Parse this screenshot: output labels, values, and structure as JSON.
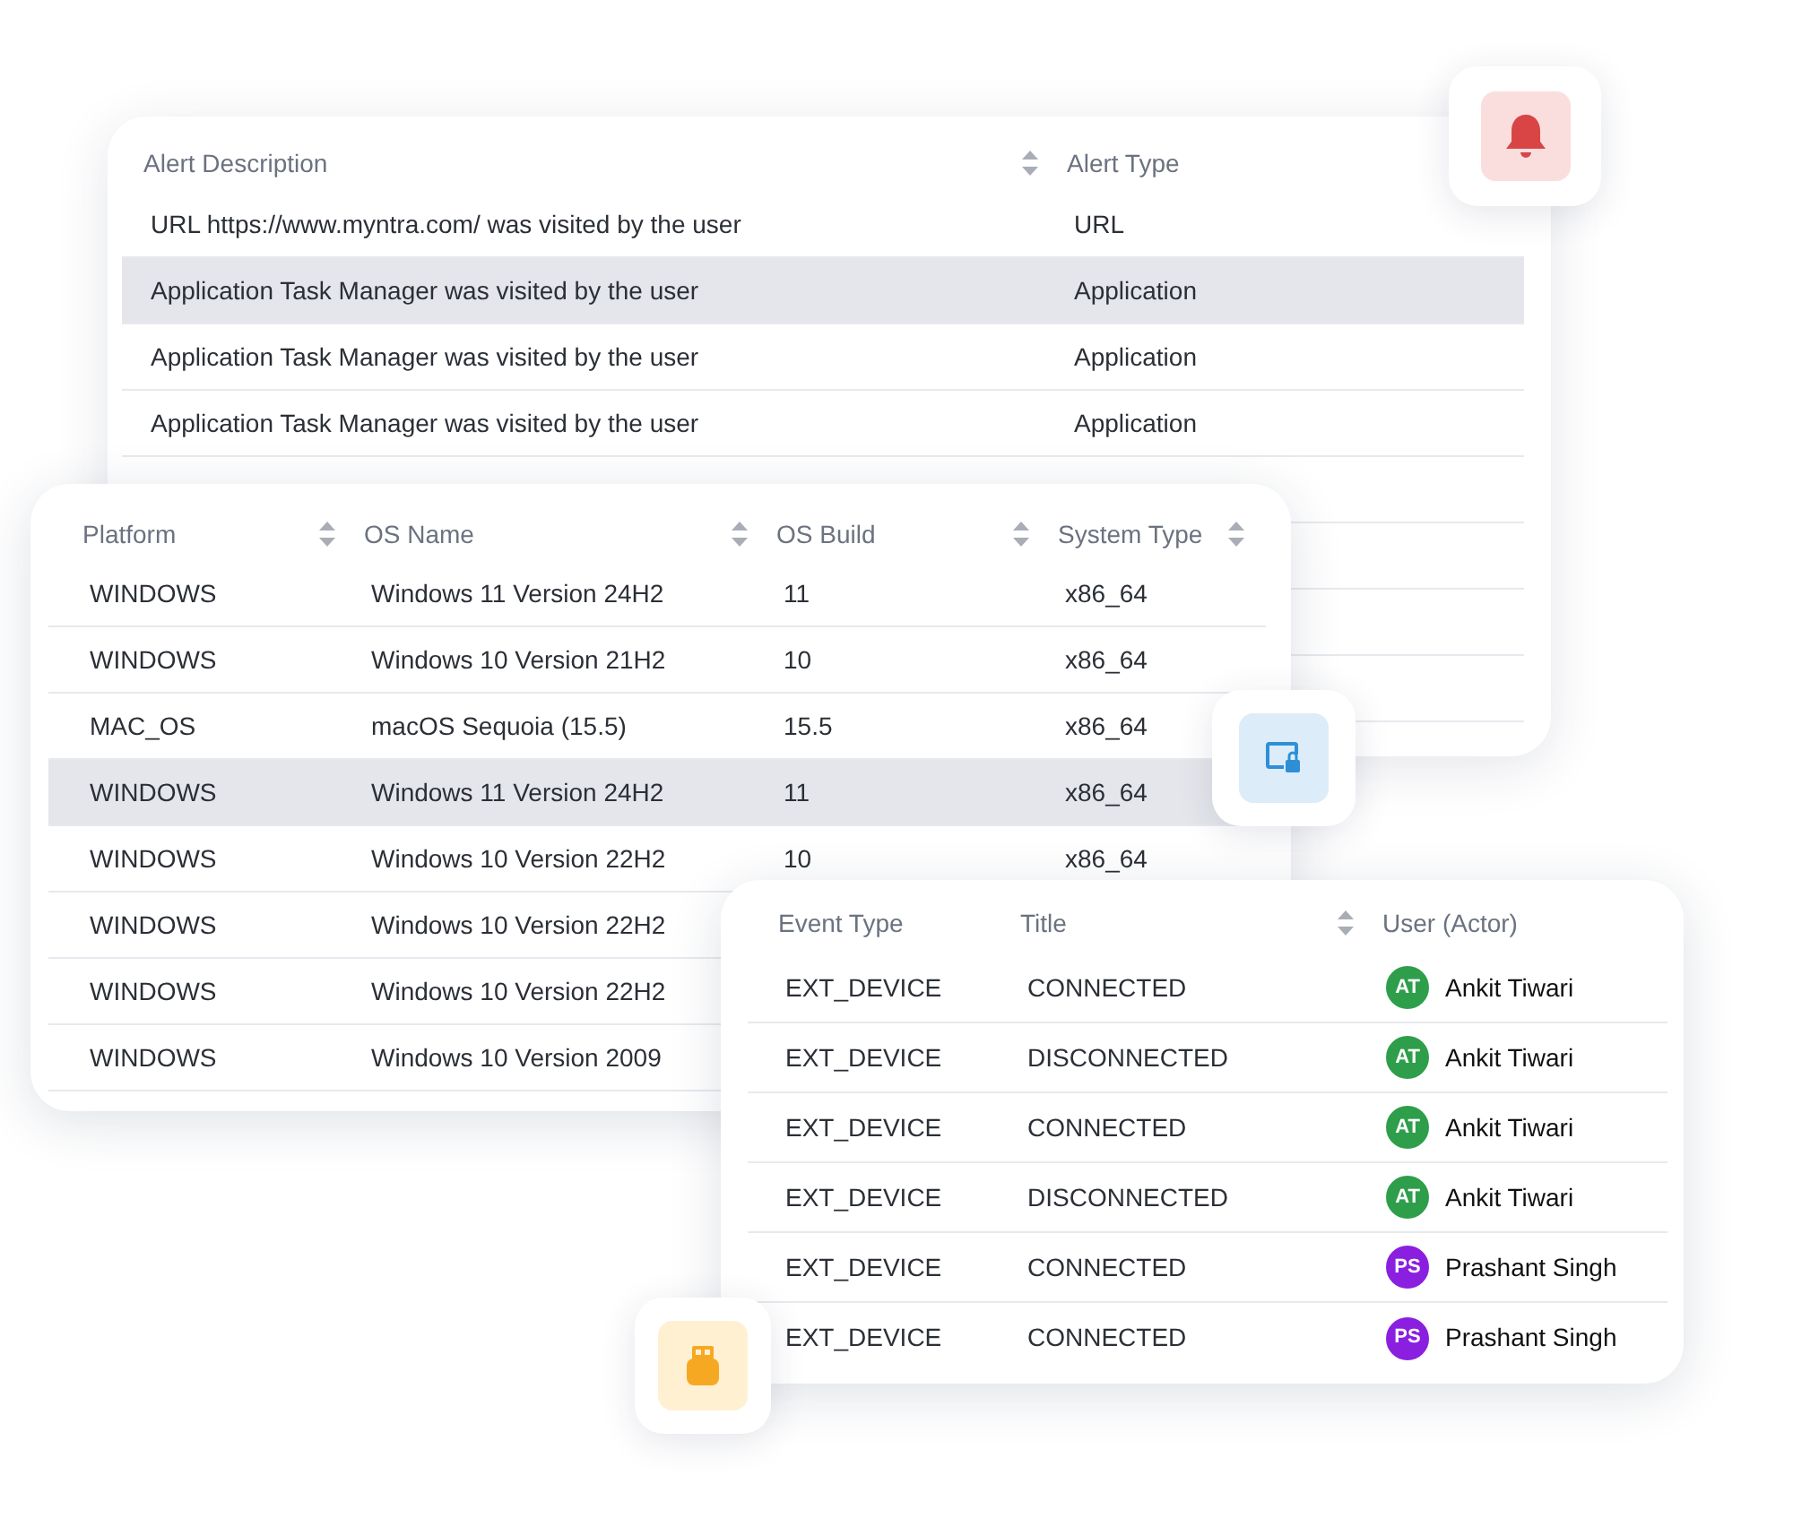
{
  "alerts_table": {
    "columns": [
      {
        "label": "Alert Description",
        "sortable": true
      },
      {
        "label": "Alert Type",
        "sortable": false
      }
    ],
    "rows": [
      {
        "cells": [
          "URL https://www.myntra.com/ was visited by the user",
          "URL"
        ],
        "highlighted": false
      },
      {
        "cells": [
          "Application Task Manager was visited by the user",
          "Application"
        ],
        "highlighted": true
      },
      {
        "cells": [
          "Application Task Manager was visited by the user",
          "Application"
        ],
        "highlighted": false
      },
      {
        "cells": [
          "Application Task Manager was visited by the user",
          "Application"
        ],
        "highlighted": false
      }
    ]
  },
  "platform_table": {
    "columns": [
      {
        "label": "Platform",
        "sortable": true
      },
      {
        "label": "OS Name",
        "sortable": true
      },
      {
        "label": "OS Build",
        "sortable": true
      },
      {
        "label": "System Type",
        "sortable": true
      }
    ],
    "rows": [
      {
        "cells": [
          "WINDOWS",
          "Windows 11 Version 24H2",
          "11",
          "x86_64"
        ],
        "highlighted": false
      },
      {
        "cells": [
          "WINDOWS",
          "Windows 10 Version 21H2",
          "10",
          "x86_64"
        ],
        "highlighted": false
      },
      {
        "cells": [
          "MAC_OS",
          "macOS Sequoia (15.5)",
          "15.5",
          "x86_64"
        ],
        "highlighted": false
      },
      {
        "cells": [
          "WINDOWS",
          "Windows 11 Version 24H2",
          "11",
          "x86_64"
        ],
        "highlighted": true
      },
      {
        "cells": [
          "WINDOWS",
          "Windows 10 Version 22H2",
          "10",
          "x86_64"
        ],
        "highlighted": false
      },
      {
        "cells": [
          "WINDOWS",
          "Windows 10 Version 22H2"
        ],
        "highlighted": false
      },
      {
        "cells": [
          "WINDOWS",
          "Windows 10 Version 22H2"
        ],
        "highlighted": false
      },
      {
        "cells": [
          "WINDOWS",
          "Windows 10 Version 2009"
        ],
        "highlighted": false
      }
    ]
  },
  "events_table": {
    "columns": [
      {
        "label": "Event Type",
        "sortable": false
      },
      {
        "label": "Title",
        "sortable": true
      },
      {
        "label": "User (Actor)",
        "sortable": false
      }
    ],
    "rows": [
      {
        "event_type": "EXT_DEVICE",
        "title": "CONNECTED",
        "user": {
          "initials": "AT",
          "name": "Ankit Tiwari",
          "color": "#2e9e4a"
        }
      },
      {
        "event_type": "EXT_DEVICE",
        "title": "DISCONNECTED",
        "user": {
          "initials": "AT",
          "name": "Ankit Tiwari",
          "color": "#2e9e4a"
        }
      },
      {
        "event_type": "EXT_DEVICE",
        "title": "CONNECTED",
        "user": {
          "initials": "AT",
          "name": "Ankit Tiwari",
          "color": "#2e9e4a"
        }
      },
      {
        "event_type": "EXT_DEVICE",
        "title": "DISCONNECTED",
        "user": {
          "initials": "AT",
          "name": "Ankit Tiwari",
          "color": "#2e9e4a"
        }
      },
      {
        "event_type": "EXT_DEVICE",
        "title": "CONNECTED",
        "user": {
          "initials": "PS",
          "name": "Prashant Singh",
          "color": "#8a1fe0"
        }
      },
      {
        "event_type": "EXT_DEVICE",
        "title": "CONNECTED",
        "user": {
          "initials": "PS",
          "name": "Prashant Singh",
          "color": "#8a1fe0"
        }
      }
    ]
  }
}
